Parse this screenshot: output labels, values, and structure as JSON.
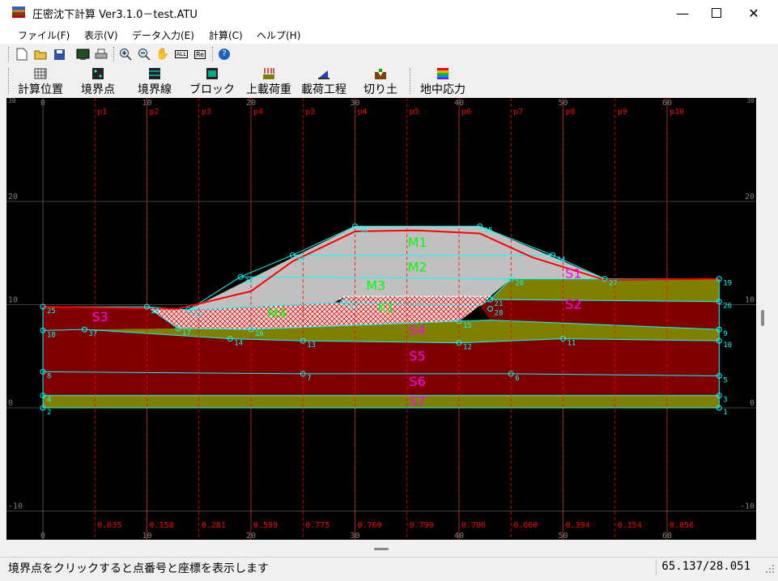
{
  "window": {
    "title": "圧密沈下計算 Ver3.1.0－test.ATU"
  },
  "menu": [
    "ファイル(F)",
    "表示(V)",
    "データ入力(E)",
    "計算(C)",
    "ヘルプ(H)"
  ],
  "toolbar_icons": [
    "new-icon",
    "open-icon",
    "save-icon",
    "csv-icon",
    "print-icon",
    "zoom-in-icon",
    "zoom-out-icon",
    "hand-icon",
    "all-icon",
    "re-icon",
    "help-icon"
  ],
  "toolbar_text": {
    "all": "ALL",
    "re": "Re",
    "help": "?"
  },
  "toolbar2": [
    "計算位置",
    "境界点",
    "境界線",
    "ブロック",
    "上載荷重",
    "載荷工程",
    "切り土",
    "地中応力"
  ],
  "status": {
    "message": "境界点をクリックすると点番号と座標を表示します",
    "coords": "65.137/28.051"
  },
  "axis": {
    "x_ticks": [
      "0",
      "10",
      "20",
      "30",
      "40",
      "50",
      "60"
    ],
    "y_ticks": [
      "20",
      "10",
      "0",
      "-10"
    ],
    "top_corner_left": "30",
    "top_corner_right": "30"
  },
  "calc_points": [
    {
      "name": "p1",
      "x": 5
    },
    {
      "name": "p2",
      "x": 10
    },
    {
      "name": "p3",
      "x": 15
    },
    {
      "name": "p4",
      "x": 20
    },
    {
      "name": "p3",
      "x": 25
    },
    {
      "name": "p4",
      "x": 30
    },
    {
      "name": "p5",
      "x": 35
    },
    {
      "name": "p6",
      "x": 40
    },
    {
      "name": "p7",
      "x": 45
    },
    {
      "name": "p8",
      "x": 50
    },
    {
      "name": "p9",
      "x": 55
    },
    {
      "name": "p10",
      "x": 60
    }
  ],
  "calc_values": [
    "0.035",
    "0.158",
    "0.281",
    "0.599",
    "0.775",
    "0.769",
    "0.799",
    "0.706",
    "0.660",
    "0.394",
    "0.154",
    "0.056"
  ],
  "layer_labels": {
    "S1": "S1",
    "S2": "S2",
    "S3": "S3",
    "S4": "S4",
    "S5": "S5",
    "S6": "S6",
    "S7": "S7",
    "M1": "M1",
    "M2": "M2",
    "M3": "M3",
    "M4": "M4",
    "K1": "K1"
  },
  "point_labels": [
    {
      "t": "1",
      "x": 65,
      "y": 0
    },
    {
      "t": "2",
      "x": 0,
      "y": 0
    },
    {
      "t": "3",
      "x": 65,
      "y": 1.2
    },
    {
      "t": "4",
      "x": 0,
      "y": 1.2
    },
    {
      "t": "5",
      "x": 65,
      "y": 3.1
    },
    {
      "t": "6",
      "x": 45,
      "y": 3.3
    },
    {
      "t": "7",
      "x": 25,
      "y": 3.3
    },
    {
      "t": "8",
      "x": 0,
      "y": 3.5
    },
    {
      "t": "9",
      "x": 65,
      "y": 7.6
    },
    {
      "t": "10",
      "x": 65,
      "y": 6.5
    },
    {
      "t": "11",
      "x": 50,
      "y": 6.7
    },
    {
      "t": "12",
      "x": 40,
      "y": 6.3
    },
    {
      "t": "13",
      "x": 25,
      "y": 6.5
    },
    {
      "t": "14",
      "x": 18,
      "y": 6.7
    },
    {
      "t": "15",
      "x": 40,
      "y": 8.4
    },
    {
      "t": "16",
      "x": 20,
      "y": 7.6
    },
    {
      "t": "17",
      "x": 13,
      "y": 7.7
    },
    {
      "t": "18",
      "x": 0,
      "y": 7.5
    },
    {
      "t": "19",
      "x": 65,
      "y": 12.5
    },
    {
      "t": "20",
      "x": 45,
      "y": 12.5
    },
    {
      "t": "21",
      "x": 43,
      "y": 10.5
    },
    {
      "t": "22",
      "x": 29,
      "y": 10.2
    },
    {
      "t": "23",
      "x": 14,
      "y": 9.5
    },
    {
      "t": "24",
      "x": 10,
      "y": 9.8
    },
    {
      "t": "25",
      "x": 0,
      "y": 9.8
    },
    {
      "t": "26",
      "x": 65,
      "y": 10.3
    },
    {
      "t": "27",
      "x": 54,
      "y": 12.5
    },
    {
      "t": "28",
      "x": 43,
      "y": 9.6
    },
    {
      "t": "30",
      "x": 19,
      "y": 12.7
    },
    {
      "t": "33",
      "x": 24,
      "y": 14.8
    },
    {
      "t": "34",
      "x": 49,
      "y": 14.8
    },
    {
      "t": "35",
      "x": 42,
      "y": 17.6
    },
    {
      "t": "36",
      "x": 30,
      "y": 17.6
    },
    {
      "t": "37",
      "x": 4,
      "y": 7.6
    }
  ],
  "colors": {
    "bg": "#000000",
    "dark_red": "#800000",
    "olive": "#808000",
    "embankment": "#c0c0c0",
    "boundary": "#00ffff",
    "red_line": "#ff0000",
    "label_magenta": "#ff00ff",
    "label_green": "#00ff00",
    "grid": "#808080",
    "calc_line": "#ff0000"
  }
}
